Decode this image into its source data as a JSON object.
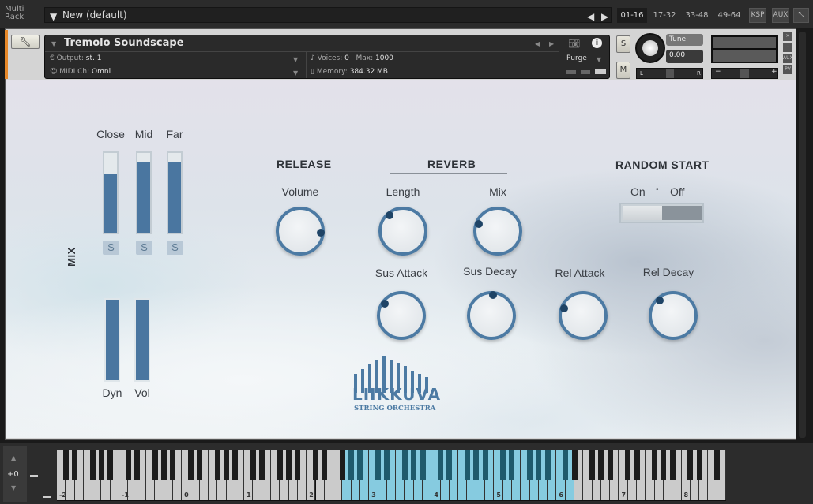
{
  "topbar": {
    "multi_rack": "Multi\nRack",
    "multi_line1": "Multi",
    "multi_line2": "Rack",
    "preset": "New (default)",
    "pages": [
      "01-16",
      "17-32",
      "33-48",
      "49-64"
    ],
    "active_page": "01-16",
    "ksp": "KSP",
    "aux": "AUX"
  },
  "instrument": {
    "name": "Tremolo Soundscape",
    "output_label": "Output:",
    "output_value": "st. 1",
    "midi_label": "MIDI Ch:",
    "midi_value": "Omni",
    "voices_label": "Voices:",
    "voices_value": "0",
    "max_label": "Max:",
    "max_value": "1000",
    "memory_label": "Memory:",
    "memory_value": "384.32 MB",
    "purge": "Purge",
    "solo": "S",
    "mute": "M",
    "tune_label": "Tune",
    "tune_value": "0.00",
    "pan_left": "L",
    "pan_right": "R",
    "vol_minus": "−",
    "vol_plus": "+",
    "side_buttons": [
      "×",
      "−",
      "AUX",
      "PV"
    ]
  },
  "panel": {
    "mix_label": "MIX",
    "mic_faders": [
      {
        "label": "Close",
        "value": 0.74,
        "solo": "S"
      },
      {
        "label": "Mid",
        "value": 0.88,
        "solo": "S"
      },
      {
        "label": "Far",
        "value": 0.88,
        "solo": "S"
      }
    ],
    "faders": [
      {
        "label": "Dyn",
        "value": 1.0
      },
      {
        "label": "Vol",
        "value": 1.0
      }
    ],
    "release_header": "RELEASE",
    "reverb_header": "REVERB",
    "random_header": "RANDOM START",
    "knobs": [
      {
        "label": "Volume",
        "angle_deg": 95
      },
      {
        "label": "Length",
        "angle_deg": -40
      },
      {
        "label": "Mix",
        "angle_deg": -70
      },
      {
        "label": "Sus Attack",
        "angle_deg": -55
      },
      {
        "label": "Sus Decay",
        "angle_deg": 5
      },
      {
        "label": "Rel Attack",
        "angle_deg": -70
      },
      {
        "label": "Rel Decay",
        "angle_deg": -42
      }
    ],
    "random_on": "On",
    "random_sep": "•",
    "random_off": "Off",
    "random_state": "On",
    "logo": "LIIKKUVA",
    "logo_sub": "STRING ORCHESTRA"
  },
  "keyboard": {
    "transpose": "+0",
    "octaves": [
      "-2",
      "-1",
      "0",
      "1",
      "2",
      "3",
      "4",
      "5",
      "6",
      "7",
      "8"
    ],
    "highlight_from": "G2",
    "highlight_to": "D6",
    "accent": "#86cbe0"
  }
}
